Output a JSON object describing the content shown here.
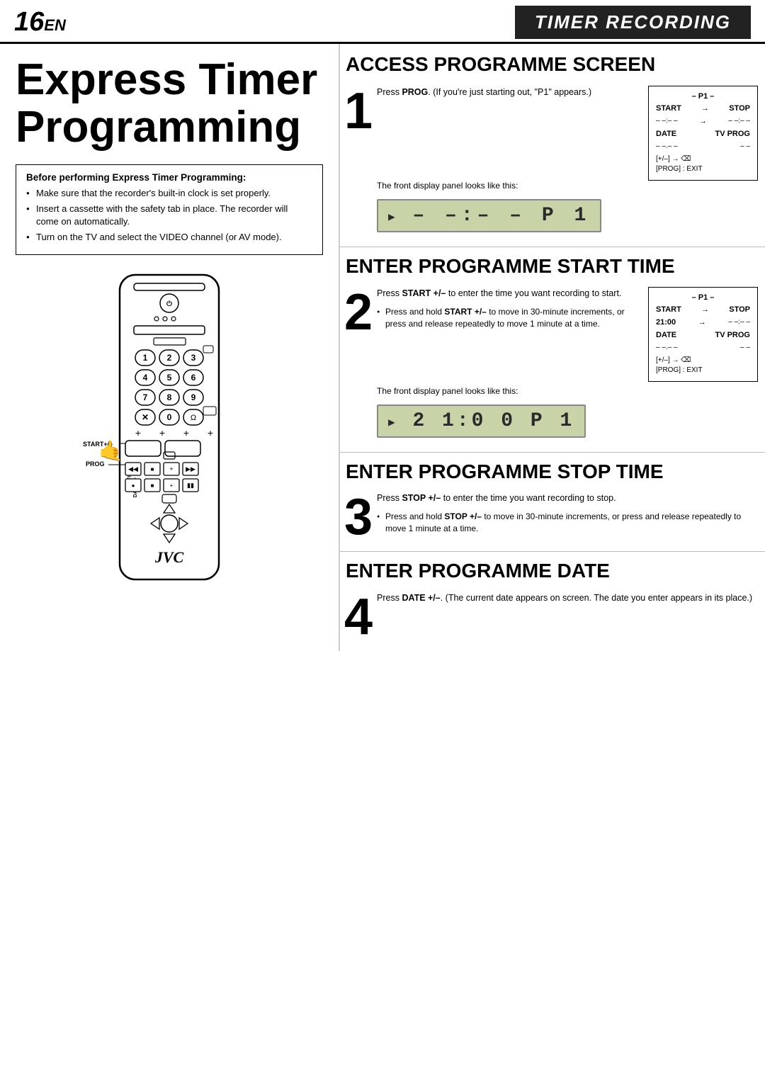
{
  "header": {
    "page_number": "16",
    "page_suffix": "EN",
    "title": "TIMER RECORDING"
  },
  "page_title_line1": "Express Timer",
  "page_title_line2": "Programming",
  "before_box": {
    "title": "Before performing Express Timer Programming:",
    "items": [
      "Make sure that the recorder's built-in clock is set properly.",
      "Insert a cassette with the safety tab in place. The recorder will come on automatically.",
      "Turn on the TV and select the VIDEO channel (or AV mode)."
    ]
  },
  "remote": {
    "label_start": "START+/–",
    "label_prog": "PROG",
    "label_stop": "STOP+/",
    "label_date": "DATE+/–",
    "jvc_logo": "JVC",
    "num_buttons": [
      "1",
      "2",
      "3",
      "4",
      "5",
      "6",
      "7",
      "8",
      "9",
      "✕",
      "0",
      "Ω"
    ]
  },
  "steps": [
    {
      "number": "1",
      "title": "ACCESS PROGRAMME SCREEN",
      "desc": "Press PROG. (If you're just starting out, \"P1\" appears.)",
      "sub_items": [],
      "display_text": "– –:– – P 1",
      "display_label": "The front display panel looks like this:",
      "screen": {
        "title": "– P1 –",
        "start_label": "START",
        "start_val": "– –:– –",
        "stop_label": "STOP",
        "stop_val": "– –:– –",
        "arrow": "→",
        "date_label": "DATE",
        "date_val": "– –.– –",
        "tvprog_label": "TV PROG",
        "tvprog_val": "– –",
        "bottom": "[+/–] → ⌫\n[PROG] : EXIT"
      }
    },
    {
      "number": "2",
      "title": "ENTER PROGRAMME START TIME",
      "desc": "Press START +/– to enter the time you want recording to start.",
      "sub_items": [
        "Press and hold START +/– to move in 30-minute increments, or press and release repeatedly to move 1 minute at a time."
      ],
      "display_text": "21:00 P 1",
      "display_label": "The front display panel looks like this:",
      "screen": {
        "title": "– P1 –",
        "start_label": "START",
        "start_val": "21:00",
        "stop_label": "STOP",
        "stop_val": "– –:– –",
        "arrow": "→",
        "date_label": "DATE",
        "date_val": "– –.– –",
        "tvprog_label": "TV PROG",
        "tvprog_val": "– –",
        "bottom": "[+/–] → ⌫\n[PROG] : EXIT"
      }
    },
    {
      "number": "3",
      "title": "ENTER PROGRAMME STOP TIME",
      "desc": "Press STOP +/– to enter the time you want recording to stop.",
      "sub_items": [
        "Press and hold STOP +/– to move in 30-minute increments, or press and release repeatedly to move 1 minute at a time."
      ],
      "display_text": null,
      "display_label": null,
      "screen": null
    },
    {
      "number": "4",
      "title": "ENTER PROGRAMME DATE",
      "desc": "Press DATE +/–. (The current date appears on screen. The date you enter appears in its place.)",
      "sub_items": [],
      "display_text": null,
      "display_label": null,
      "screen": null
    }
  ]
}
